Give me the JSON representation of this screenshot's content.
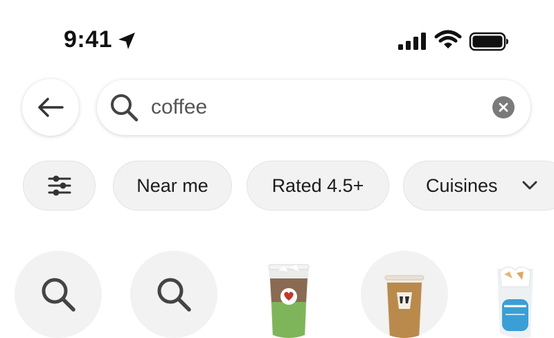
{
  "status_bar": {
    "time": "9:41",
    "icons": [
      "location-arrow-icon",
      "cellular-signal-icon",
      "wifi-icon",
      "battery-icon"
    ]
  },
  "search": {
    "value": "coffee",
    "icons": [
      "back-arrow-icon",
      "search-icon",
      "clear-icon"
    ]
  },
  "filters": {
    "items": [
      {
        "label": "",
        "icon": "sliders-icon"
      },
      {
        "label": "Near me"
      },
      {
        "label": "Rated 4.5+"
      },
      {
        "label": "Cuisines",
        "icon": "chevron-down-icon"
      }
    ]
  },
  "suggestions": {
    "items": [
      {
        "type": "search",
        "icon": "search-icon"
      },
      {
        "type": "search",
        "icon": "search-icon"
      },
      {
        "type": "image",
        "icon": "matcha-latte-image"
      },
      {
        "type": "image",
        "icon": "mccafe-iced-coffee-image"
      },
      {
        "type": "image",
        "icon": "iced-drink-image"
      }
    ]
  },
  "colors": {
    "background": "#ffffff",
    "chip_bg": "#f2f2f2",
    "text": "#1c1c1c",
    "clear_button": "#7a7a7a"
  }
}
